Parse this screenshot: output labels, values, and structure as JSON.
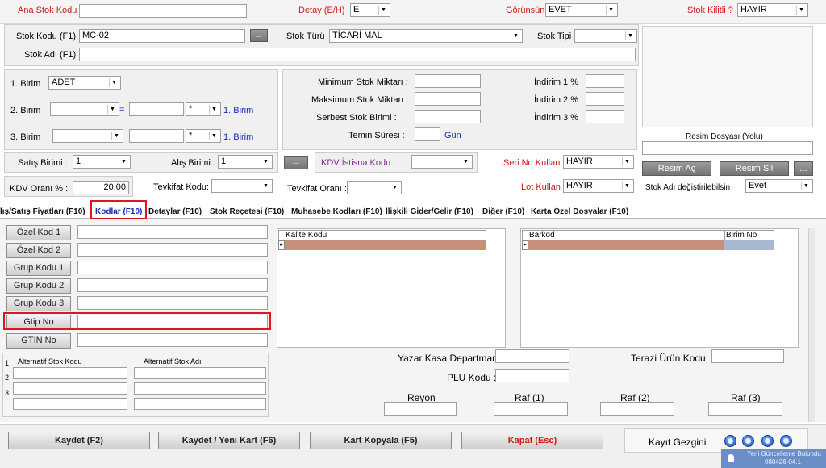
{
  "top": {
    "ana_stok_kodu_label": "Ana Stok Kodu",
    "ana_stok_kodu_value": "",
    "detay_label": "Detay (E/H)",
    "detay_value": "E",
    "gorunsun_label": "Görünsün",
    "gorunsun_value": "EVET",
    "stok_kilitli_label": "Stok Kilitli ?",
    "stok_kilitli_value": "HAYIR"
  },
  "stok": {
    "kodu_label": "Stok Kodu (F1)",
    "kodu_value": "MC-02",
    "browse_label": "...",
    "turu_label": "Stok Türü",
    "turu_value": "TİCARİ MAL",
    "tipi_label": "Stok Tipi",
    "tipi_value": "",
    "adi_label": "Stok Adı (F1)",
    "adi_value": ""
  },
  "birim": {
    "b1_label": "1. Birim",
    "b1_value": "ADET",
    "b2_label": "2. Birim",
    "b3_label": "3. Birim",
    "eq": "=",
    "mul": "*",
    "birim_ref": "1. Birim"
  },
  "miktar": {
    "min_label": "Minimum Stok Miktarı :",
    "max_label": "Maksimum Stok Miktarı :",
    "serbest_label": "Serbest Stok Birimi :",
    "temin_label": "Temin Süresi :",
    "gun_label": "Gün",
    "ind1_label": "İndirim 1 %",
    "ind2_label": "İndirim 2 %",
    "ind3_label": "İndirim 3 %"
  },
  "resim": {
    "dosya_label": "Resim Dosyası (Yolu)",
    "ac_label": "Resim Aç",
    "sil_label": "Resim Sil",
    "dots": "...",
    "degistir_label": "Stok Adı değiştirilebilsin",
    "degistir_value": "Evet"
  },
  "satis": {
    "satis_birimi_label": "Satış Birimi :",
    "satis_birimi_value": "1",
    "alis_birimi_label": "Alış Birimi :",
    "alis_birimi_value": "1",
    "kdv_istisna_btn": "...",
    "kdv_istisna_label": "KDV İstisna Kodu :",
    "seri_no_label": "Seri No Kullan",
    "seri_no_value": "HAYIR",
    "kdv_orani_label": "KDV Oranı % :",
    "kdv_orani_value": "20,00",
    "tevkifat_kodu_label": "Tevkifat Kodu:",
    "tevkifat_orani_label": "Tevkifat Oranı :",
    "lot_label": "Lot Kullan",
    "lot_value": "HAYIR"
  },
  "tabs": [
    "lış/Satış Fiyatları (F10)",
    "Kodlar (F10)",
    "Detaylar  (F10)",
    "Stok Reçetesi  (F10)",
    "Muhasebe Kodları (F10)",
    "İlişkili Gider/Gelir  (F10)",
    "Diğer (F10)",
    "Karta Özel Dosyalar (F10)"
  ],
  "kodlar": {
    "buttons": [
      "Özel Kod 1",
      "Özel Kod 2",
      "Grup Kodu 1",
      "Grup Kodu 2",
      "Grup Kodu 3",
      "Gtip No",
      "GTIN No"
    ],
    "kalite_kodu_header": "Kalite Kodu",
    "barkod_header": "Barkod",
    "birim_no_header": "Birim No",
    "alt_stok_kodu_header": "Alternatif Stok Kodu",
    "alt_stok_adi_header": "Alternatif Stok Adı",
    "alt_rows": [
      "1",
      "2",
      "3"
    ]
  },
  "kasa": {
    "yazar_kasa_label": "Yazar Kasa Departman :",
    "plu_label": "PLU Kodu :",
    "terazi_label": "Terazi Ürün Kodu",
    "reyon_label": "Reyon",
    "raf1_label": "Raf (1)",
    "raf2_label": "Raf (2)",
    "raf3_label": "Raf (3)"
  },
  "bottom": {
    "kaydet": "Kaydet (F2)",
    "kaydet_yeni": "Kaydet / Yeni Kart (F6)",
    "kart_kopyala": "Kart Kopyala (F5)",
    "kapat": "Kapat (Esc)",
    "kayit_gezgini": "Kayıt Gezgini"
  },
  "toast": {
    "line1": "Yeni Güncelleme Bulundu",
    "line2": "080426-04.1"
  },
  "colors": {
    "accent_red": "#d01818",
    "highlight_box": "#e0161a",
    "grid_row": "#c8907a",
    "grid_cell_blue": "#a8b8d0"
  }
}
